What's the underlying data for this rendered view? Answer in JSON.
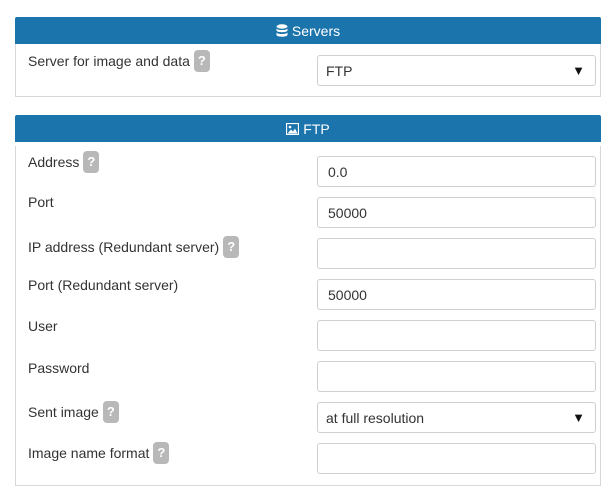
{
  "servers_panel": {
    "title": "Servers",
    "icon": "database-icon",
    "server_label": "Server for image and data",
    "server_value": "FTP"
  },
  "ftp_panel": {
    "title": "FTP",
    "icon": "image-icon",
    "help_glyph": "?",
    "caret_glyph": "▼",
    "fields": {
      "address": {
        "label": "Address",
        "value": "0.0"
      },
      "port": {
        "label": "Port",
        "value": "50000"
      },
      "ip_redundant": {
        "label": "IP address (Redundant server)",
        "value": ""
      },
      "port_redundant": {
        "label": "Port (Redundant server)",
        "value": "50000"
      },
      "user": {
        "label": "User",
        "value": ""
      },
      "password": {
        "label": "Password",
        "value": ""
      },
      "sent_image": {
        "label": "Sent image",
        "value": "at full resolution"
      },
      "image_name_format": {
        "label": "Image name format",
        "value": ""
      }
    }
  },
  "colors": {
    "header_bg": "#1c74ad",
    "help_bg": "#b8b8b8",
    "border": "#d8d8d8"
  }
}
